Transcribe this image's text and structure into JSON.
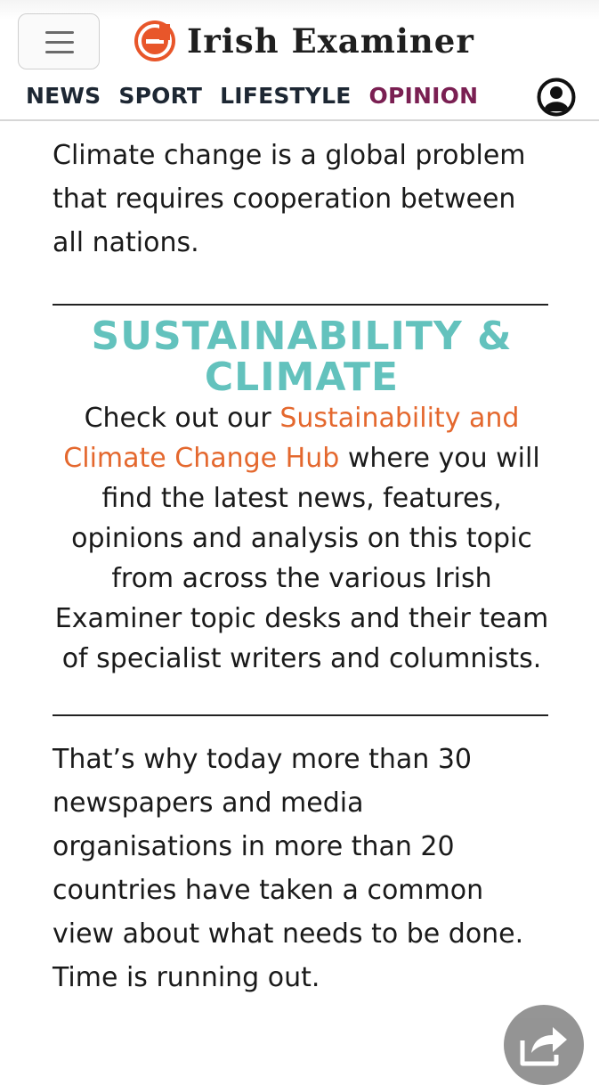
{
  "header": {
    "brand_name": "Irish Examiner",
    "nav": [
      {
        "label": "NEWS",
        "active": false
      },
      {
        "label": "SPORT",
        "active": false
      },
      {
        "label": "LIFESTYLE",
        "active": false
      },
      {
        "label": "OPINION",
        "active": true
      }
    ],
    "icons": {
      "menu": "hamburger-menu-icon",
      "account": "user-account-icon",
      "logo": "examiner-e-icon"
    }
  },
  "article": {
    "paragraph_1": "Climate change is a global problem that requires cooperation between all nations.",
    "promo": {
      "title": "SUSTAINABILITY & CLIMATE",
      "text_before": "Check out our ",
      "link_text": "Sustainability and Climate Change Hub",
      "text_after": " where you will find the latest news, features, opinions and analysis on this topic from across the various Irish Examiner topic desks and their team of specialist writers and columnists."
    },
    "paragraph_2": "That’s why today more than 30 newspapers and media organisations in more than 20 countries have taken a common view about what needs to be done. Time is running out."
  },
  "colors": {
    "accent_teal": "#63c2bd",
    "link_orange": "#e4682e",
    "opinion_purple": "#7a1f52",
    "logo_orange": "#e8562a"
  },
  "floating": {
    "share_icon": "share-arrow-icon"
  }
}
